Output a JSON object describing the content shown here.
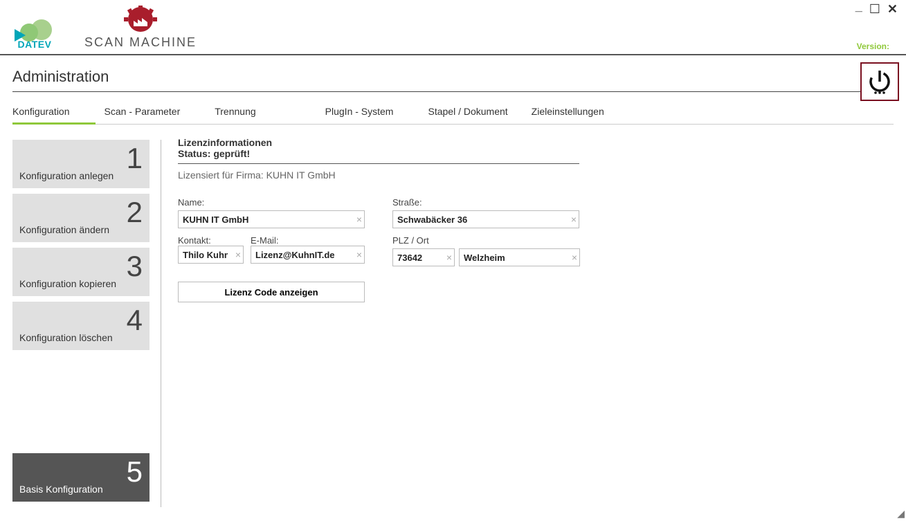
{
  "window": {
    "minimize": "_",
    "maximize": "☐",
    "close": "✕"
  },
  "header": {
    "datev_text": "DATEV",
    "scan_text": "SCAN MACHINE",
    "version_label": "Version:"
  },
  "page_title": "Administration",
  "tabs": [
    {
      "label": "Konfiguration",
      "active": true
    },
    {
      "label": "Scan - Parameter",
      "active": false
    },
    {
      "label": "Trennung",
      "active": false
    },
    {
      "label": "PlugIn - System",
      "active": false
    },
    {
      "label": "Stapel / Dokument",
      "active": false
    },
    {
      "label": "Zieleinstellungen",
      "active": false
    }
  ],
  "sidebar": {
    "items": [
      {
        "label": "Konfiguration anlegen",
        "num": "1"
      },
      {
        "label": "Konfiguration ändern",
        "num": "2"
      },
      {
        "label": "Konfiguration kopieren",
        "num": "3"
      },
      {
        "label": "Konfiguration löschen",
        "num": "4"
      }
    ],
    "bottom": {
      "label": "Basis Konfiguration",
      "num": "5"
    }
  },
  "license": {
    "heading": "Lizenzinformationen",
    "status": "Status: geprüft!",
    "for": "Lizensiert für Firma: KUHN IT GmbH",
    "labels": {
      "name": "Name:",
      "street": "Straße:",
      "contact": "Kontakt:",
      "email": "E-Mail:",
      "plz_city": "PLZ / Ort"
    },
    "values": {
      "name": "KUHN IT GmbH",
      "street": "Schwabäcker 36",
      "contact": "Thilo Kuhn",
      "email": "Lizenz@KuhnIT.de",
      "plz": "73642",
      "city": "Welzheim"
    },
    "show_code_btn": "Lizenz Code anzeigen"
  }
}
